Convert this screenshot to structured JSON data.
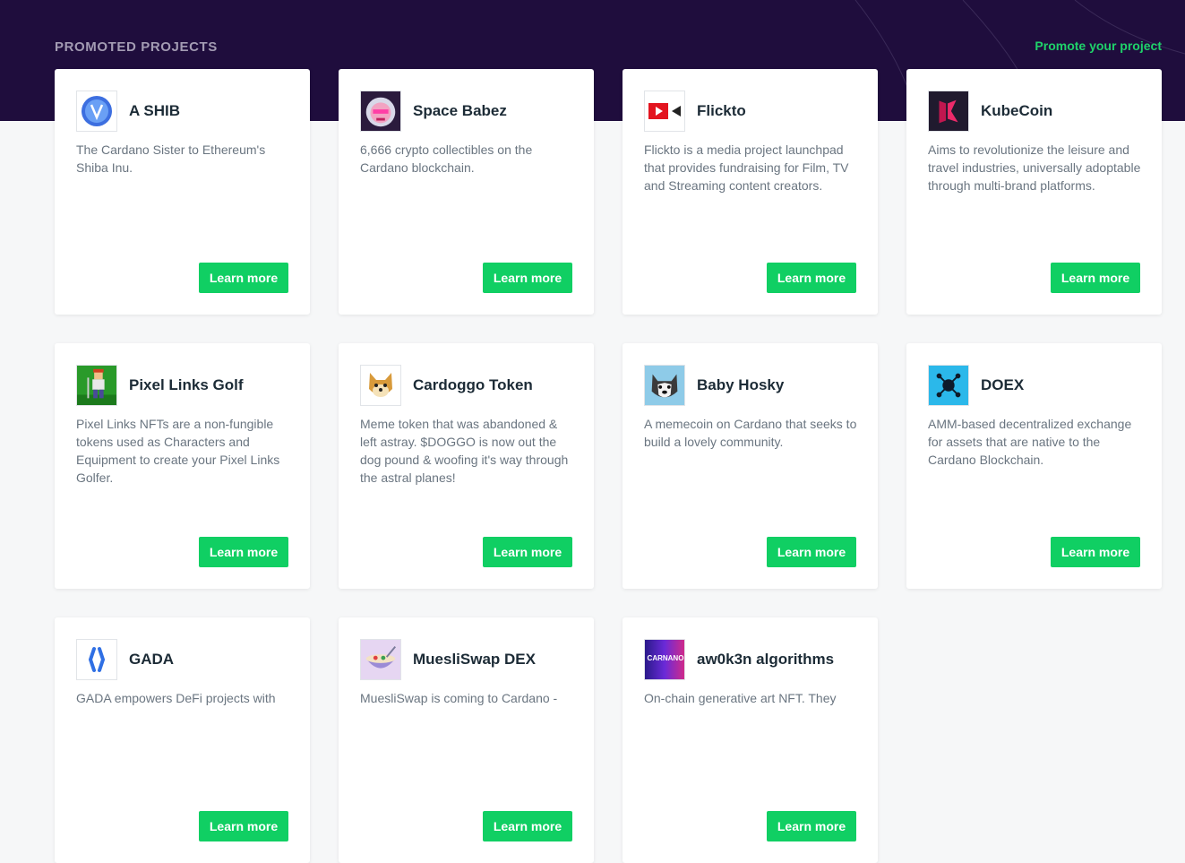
{
  "section": {
    "title": "PROMOTED PROJECTS",
    "promote_link": "Promote your project"
  },
  "colors": {
    "hero_bg": "#1f0d3d",
    "accent_green": "#10cf63",
    "page_bg": "#f6f7f8"
  },
  "projects": [
    {
      "name": "A SHIB",
      "description": "The Cardano Sister to Ethereum's Shiba Inu.",
      "button": "Learn more",
      "icon": "ashib-logo-icon"
    },
    {
      "name": "Space Babez",
      "description": "6,666 crypto collectibles on the Cardano blockchain.",
      "button": "Learn more",
      "icon": "space-babez-logo-icon"
    },
    {
      "name": "Flickto",
      "description": "Flickto is a media project launchpad that provides fundraising for Film, TV and Streaming content creators.",
      "button": "Learn more",
      "icon": "flickto-logo-icon"
    },
    {
      "name": "KubeCoin",
      "description": "Aims to revolutionize the leisure and travel industries, universally adoptable through multi-brand platforms.",
      "button": "Learn more",
      "icon": "kubecoin-logo-icon"
    },
    {
      "name": "Pixel Links Golf",
      "description": "Pixel Links NFTs are a non-fungible tokens used as Characters and Equipment to create your Pixel Links Golfer.",
      "button": "Learn more",
      "icon": "pixel-golfer-logo-icon"
    },
    {
      "name": "Cardoggo Token",
      "description": "Meme token that was abandoned & left astray. $DOGGO is now out the dog pound & woofing it's way through the astral planes!",
      "button": "Learn more",
      "icon": "doggo-logo-icon"
    },
    {
      "name": "Baby Hosky",
      "description": "A memecoin on Cardano that seeks to build a lovely community.",
      "button": "Learn more",
      "icon": "husky-logo-icon"
    },
    {
      "name": "DOEX",
      "description": "AMM-based decentralized exchange for assets that are native to the Cardano Blockchain.",
      "button": "Learn more",
      "icon": "doex-logo-icon"
    },
    {
      "name": "GADA",
      "description": "GADA empowers DeFi projects with",
      "button": "Learn more",
      "icon": "gada-logo-icon"
    },
    {
      "name": "MuesliSwap DEX",
      "description": "MuesliSwap is coming to Cardano -",
      "button": "Learn more",
      "icon": "muesli-bowl-logo-icon"
    },
    {
      "name": "aw0k3n algorithms",
      "description": "On-chain generative art NFT. They",
      "button": "Learn more",
      "icon": "awoken-logo-icon",
      "logo_text": "CARNANO"
    }
  ]
}
